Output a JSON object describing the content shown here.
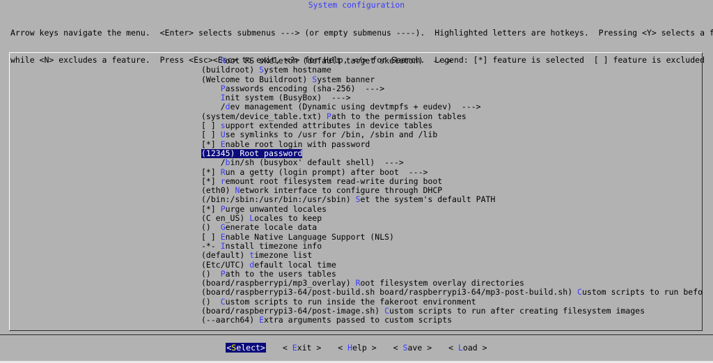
{
  "title": "System configuration",
  "help_lines": [
    "Arrow keys navigate the menu.  <Enter> selects submenus ---> (or empty submenus ----).  Highlighted letters are hotkeys.  Pressing <Y> selects a feature,",
    "while <N> excludes a feature.  Press <Esc><Esc> to exit, <?> for Help, </> for Search.  Legend: [*] feature is selected  [ ] feature is excluded"
  ],
  "items": [
    {
      "pre": "    ",
      "hk": "R",
      "post": "oot FS skeleton (default target skeleton)  --->"
    },
    {
      "pre": "(buildroot) ",
      "hk": "S",
      "post": "ystem hostname"
    },
    {
      "pre": "(Welcome to Buildroot) ",
      "hk": "S",
      "post": "ystem banner"
    },
    {
      "pre": "    ",
      "hk": "P",
      "post": "asswords encoding (sha-256)  --->"
    },
    {
      "pre": "    ",
      "hk": "I",
      "post": "nit system (BusyBox)  --->"
    },
    {
      "pre": "    /",
      "hk": "d",
      "post": "ev management (Dynamic using devtmpfs + eudev)  --->"
    },
    {
      "pre": "(system/device_table.txt) ",
      "hk": "P",
      "post": "ath to the permission tables"
    },
    {
      "pre": "[ ] ",
      "hk": "s",
      "post": "upport extended attributes in device tables"
    },
    {
      "pre": "[ ] ",
      "hk": "U",
      "post": "se symlinks to /usr for /bin, /sbin and /lib"
    },
    {
      "pre": "[*] ",
      "hk": "E",
      "post": "nable root login with password"
    },
    {
      "pre": "(12345) ",
      "hk": "R",
      "post": "oot password"
    },
    {
      "pre": "    /",
      "hk": "b",
      "post": "in/sh (busybox' default shell)  --->"
    },
    {
      "pre": "[*] ",
      "hk": "R",
      "post": "un a getty (login prompt) after boot  --->"
    },
    {
      "pre": "[*] ",
      "hk": "r",
      "post": "emount root filesystem read-write during boot"
    },
    {
      "pre": "(eth0) ",
      "hk": "N",
      "post": "etwork interface to configure through DHCP"
    },
    {
      "pre": "(/bin:/sbin:/usr/bin:/usr/sbin) ",
      "hk": "S",
      "post": "et the system's default PATH"
    },
    {
      "pre": "[*] ",
      "hk": "P",
      "post": "urge unwanted locales"
    },
    {
      "pre": "(C en_US) ",
      "hk": "L",
      "post": "ocales to keep"
    },
    {
      "pre": "()  ",
      "hk": "G",
      "post": "enerate locale data"
    },
    {
      "pre": "[ ] ",
      "hk": "E",
      "post": "nable Native Language Support (NLS)"
    },
    {
      "pre": "-*- ",
      "hk": "I",
      "post": "nstall timezone info"
    },
    {
      "pre": "(default) ",
      "hk": "t",
      "post": "imezone list"
    },
    {
      "pre": "(Etc/UTC) ",
      "hk": "d",
      "post": "efault local time"
    },
    {
      "pre": "()  ",
      "hk": "P",
      "post": "ath to the users tables"
    },
    {
      "pre": "(board/raspberrypi/mp3_overlay) ",
      "hk": "R",
      "post": "oot filesystem overlay directories"
    },
    {
      "pre": "(board/raspberrypi3-64/post-build.sh board/raspberrypi3-64/mp3-post-build.sh) ",
      "hk": "C",
      "post": "ustom scripts to run before creati"
    },
    {
      "pre": "()  ",
      "hk": "C",
      "post": "ustom scripts to run inside the fakeroot environment"
    },
    {
      "pre": "(board/raspberrypi3-64/post-image.sh) ",
      "hk": "C",
      "post": "ustom scripts to run after creating filesystem images"
    },
    {
      "pre": "(--aarch64) ",
      "hk": "E",
      "post": "xtra arguments passed to custom scripts"
    }
  ],
  "selected_index": 10,
  "buttons": [
    {
      "pre": "<",
      "hk": "S",
      "post": "elect>",
      "selected": true
    },
    {
      "pre": "< ",
      "hk": "E",
      "post": "xit >",
      "selected": false
    },
    {
      "pre": "< ",
      "hk": "H",
      "post": "elp >",
      "selected": false
    },
    {
      "pre": "< ",
      "hk": "S",
      "post": "ave >",
      "selected": false
    },
    {
      "pre": "< ",
      "hk": "L",
      "post": "oad >",
      "selected": false
    }
  ],
  "colors": {
    "background": "#b2b2b2",
    "hotkey": "#3a3aff",
    "selection": "#0b0b7b"
  }
}
